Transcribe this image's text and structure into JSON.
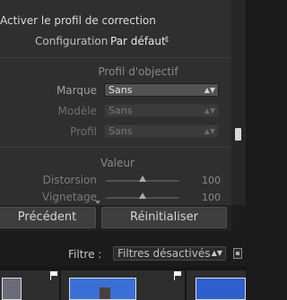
{
  "panel": {
    "enable_label": "Activer le profil de correction",
    "config_label": "Configuration",
    "config_value": "Par défaut",
    "config_arrows": "⇕",
    "lens_profile_title": "Profil d'objectif",
    "fields": [
      {
        "label": "Marque",
        "value": "Sans",
        "enabled": true
      },
      {
        "label": "Modèle",
        "value": "Sans",
        "enabled": false
      },
      {
        "label": "Profil",
        "value": "Sans",
        "enabled": false
      }
    ],
    "amount_title": "Valeur",
    "sliders": [
      {
        "label": "Distorsion",
        "value": "100",
        "level": 0.5
      },
      {
        "label": "Vignetage",
        "value": "100",
        "level": 0.5
      }
    ]
  },
  "buttons": {
    "previous": "Précédent",
    "reset": "Réinitialiser"
  },
  "filter": {
    "label": "Filtre :",
    "value": "Filtres désactivés"
  },
  "colors": {
    "panel_bg": "#2f2f2f",
    "button_bg": "#3e3e3e",
    "sky": "#3a6fd8"
  }
}
